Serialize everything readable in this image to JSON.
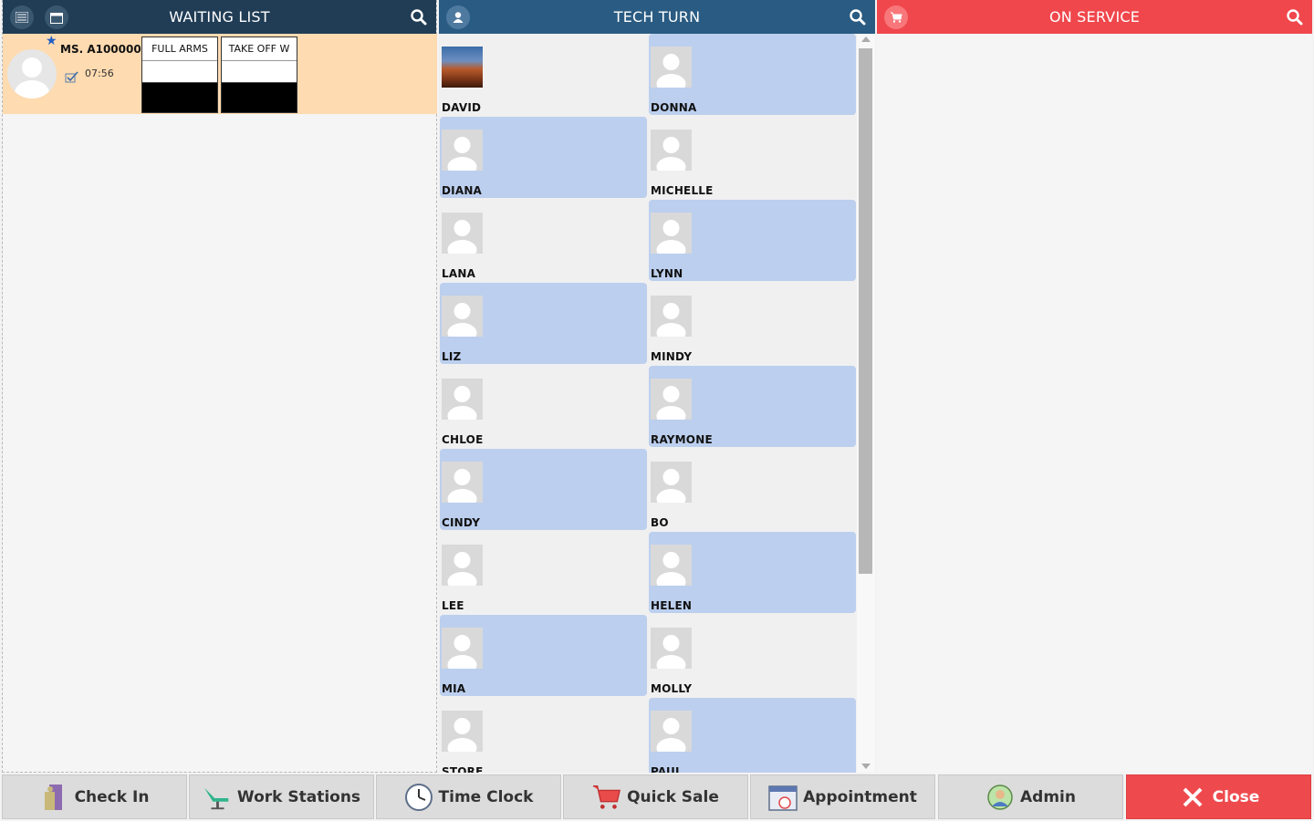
{
  "waiting": {
    "title": "WAITING LIST",
    "ticket": {
      "customer": "MS. A100000",
      "time": "07:56",
      "services": [
        "FULL ARMS",
        "TAKE OFF W"
      ]
    }
  },
  "tech_turn": {
    "title": "TECH TURN",
    "techs": [
      {
        "name": "DAVID",
        "highlight": false,
        "photo": true
      },
      {
        "name": "DONNA",
        "highlight": true,
        "photo": false
      },
      {
        "name": "DIANA",
        "highlight": true,
        "photo": false
      },
      {
        "name": "MICHELLE",
        "highlight": false,
        "photo": false
      },
      {
        "name": "LANA",
        "highlight": false,
        "photo": false
      },
      {
        "name": "LYNN",
        "highlight": true,
        "photo": false
      },
      {
        "name": "LIZ",
        "highlight": true,
        "photo": false
      },
      {
        "name": "MINDY",
        "highlight": false,
        "photo": false
      },
      {
        "name": "CHLOE",
        "highlight": false,
        "photo": false
      },
      {
        "name": "RAYMONE",
        "highlight": true,
        "photo": false
      },
      {
        "name": "CINDY",
        "highlight": true,
        "photo": false
      },
      {
        "name": "BO",
        "highlight": false,
        "photo": false
      },
      {
        "name": "LEE",
        "highlight": false,
        "photo": false
      },
      {
        "name": "HELEN",
        "highlight": true,
        "photo": false
      },
      {
        "name": "MIA",
        "highlight": true,
        "photo": false
      },
      {
        "name": "MOLLY",
        "highlight": false,
        "photo": false
      },
      {
        "name": "STORE",
        "highlight": false,
        "photo": false
      },
      {
        "name": "PAUL",
        "highlight": true,
        "photo": false
      }
    ]
  },
  "on_service": {
    "title": "ON SERVICE"
  },
  "toolbar": {
    "check_in": "Check In",
    "work_stations": "Work Stations",
    "time_clock": "Time Clock",
    "quick_sale": "Quick Sale",
    "appointment": "Appointment",
    "admin": "Admin",
    "close": "Close"
  },
  "colors": {
    "waiting_header": "#213d56",
    "tech_header": "#2a5b82",
    "service_header": "#f0474c",
    "tech_highlight": "#bccfee",
    "ticket_bg": "#fedbb0",
    "close_button": "#ee4a4e"
  }
}
